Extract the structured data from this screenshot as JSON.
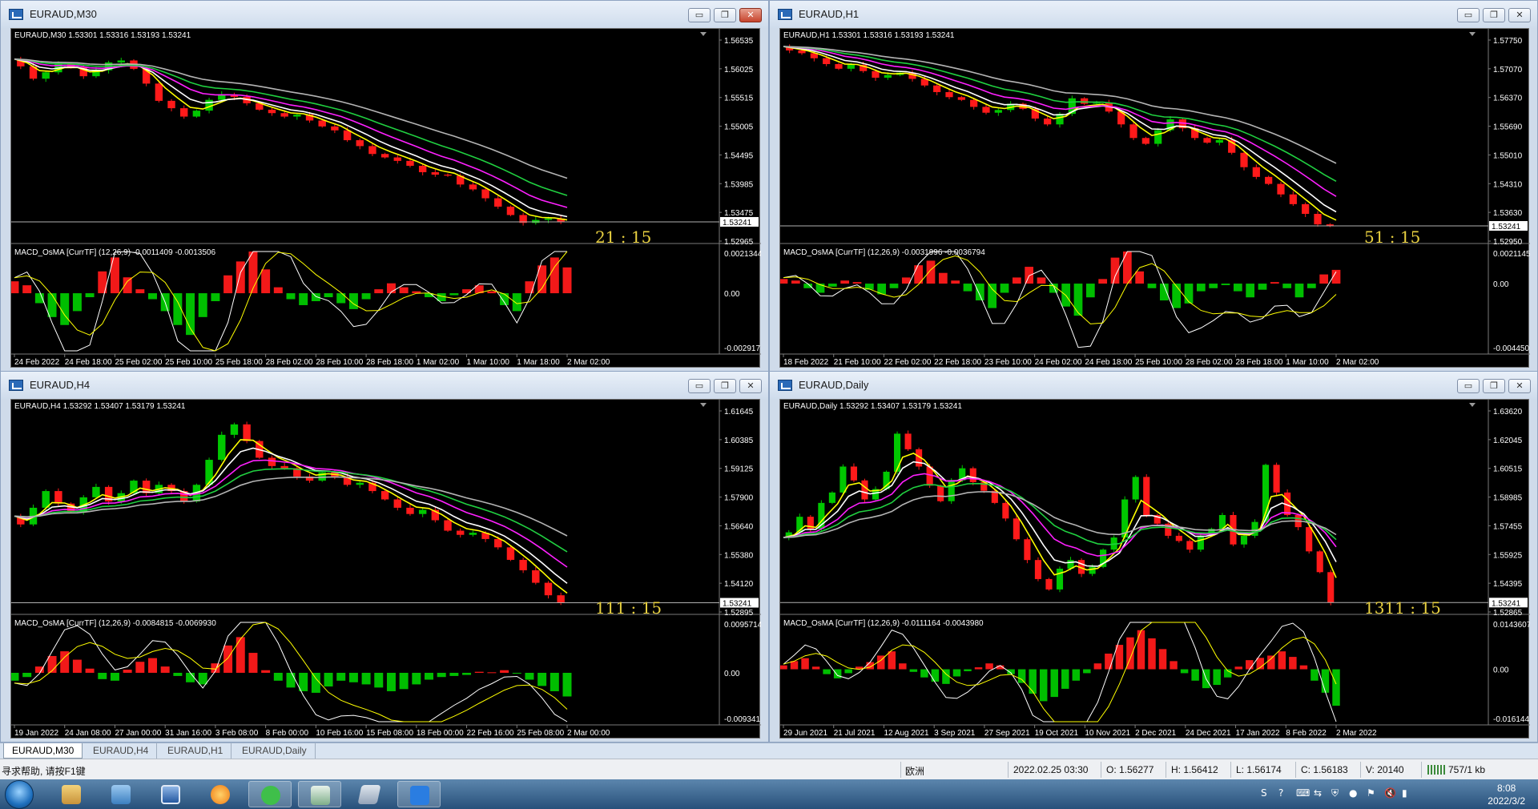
{
  "colors": {
    "up": "#00c800",
    "down": "#ff1a1a",
    "ema1": "#ffff00",
    "ema2": "#ffffff",
    "ema3": "#ff20ff",
    "ema4": "#20d040",
    "ema5": "#b4b4b4",
    "grid": "#7a7a7a",
    "text": "#ffffff",
    "timer": "#e8d040"
  },
  "windows": [
    {
      "title": "EURAUD,M30",
      "ohlc_label": "EURAUD,M30  1.53301 1.53316 1.53193 1.53241",
      "price_labels": [
        "1.56535",
        "1.56025",
        "1.55515",
        "1.55005",
        "1.54495",
        "1.53985",
        "1.53475",
        "1.52965"
      ],
      "last_price": "1.53241",
      "timer": "21 : 15",
      "macd_label": "MACD_OsMA [CurrTF] (12,26,9) -0.0011409 -0.0013506",
      "macd_labels": [
        "0.0021344",
        "0.00",
        "-0.002917"
      ],
      "time_labels": [
        "24 Feb 2022",
        "24 Feb 18:00",
        "25 Feb 02:00",
        "25 Feb 10:00",
        "25 Feb 18:00",
        "28 Feb 02:00",
        "28 Feb 10:00",
        "28 Feb 18:00",
        "1 Mar 02:00",
        "1 Mar 10:00",
        "1 Mar 18:00",
        "2 Mar 02:00"
      ],
      "buttons": {
        "minimize": "▭",
        "restore": "❐",
        "close": "✕"
      },
      "chart_data": {
        "type": "candlestick",
        "ylim": [
          1.5285,
          1.57
        ],
        "price_path": [
          1.5655,
          1.564,
          1.5615,
          1.5628,
          1.5645,
          1.5638,
          1.562,
          1.5632,
          1.5648,
          1.5652,
          1.5635,
          1.5605,
          1.557,
          1.5555,
          1.5538,
          1.555,
          1.5572,
          1.5583,
          1.5578,
          1.5565,
          1.5552,
          1.5545,
          1.5538,
          1.5542,
          1.553,
          1.5518,
          1.551,
          1.549,
          1.5478,
          1.5462,
          1.5455,
          1.5448,
          1.5438,
          1.5425,
          1.542,
          1.5418,
          1.54,
          1.539,
          1.5372,
          1.5355,
          1.5338,
          1.5322,
          1.5328,
          1.5331,
          1.5324
        ],
        "macd_hist": [
          0.0006,
          0.0004,
          -0.0005,
          -0.0012,
          -0.0016,
          -0.0009,
          -0.0002,
          0.0011,
          0.0018,
          0.0008,
          0.0002,
          -0.0003,
          -0.0009,
          -0.0016,
          -0.0021,
          -0.0012,
          -0.0004,
          0.0009,
          0.0016,
          0.0021,
          0.0012,
          0.0003,
          -0.0003,
          -0.0006,
          -0.0004,
          -0.0002,
          -0.0005,
          -0.0008,
          -0.0003,
          0.0002,
          0.0005,
          0.0003,
          0.0001,
          -0.0002,
          -0.0004,
          -0.0001,
          0.0002,
          0.0004,
          0.0001,
          -0.0006,
          -0.0009,
          0.0006,
          0.0014,
          0.0018,
          0.0013
        ],
        "macd_range": [
          -0.0029,
          0.0021
        ]
      }
    },
    {
      "title": "EURAUD,H1",
      "ohlc_label": "EURAUD,H1  1.53301 1.53316 1.53193 1.53241",
      "price_labels": [
        "1.57750",
        "1.57070",
        "1.56370",
        "1.55690",
        "1.55010",
        "1.54310",
        "1.53630",
        "1.52950"
      ],
      "last_price": "1.53241",
      "timer": "51 : 15",
      "macd_label": "MACD_OsMA [CurrTF] (12,26,9) -0.0031996 -0.0036794",
      "macd_labels": [
        "0.0021145",
        "0.00",
        "-0.004450"
      ],
      "time_labels": [
        "18 Feb 2022",
        "21 Feb 10:00",
        "22 Feb 02:00",
        "22 Feb 18:00",
        "23 Feb 10:00",
        "24 Feb 02:00",
        "24 Feb 18:00",
        "25 Feb 10:00",
        "28 Feb 02:00",
        "28 Feb 18:00",
        "1 Mar 10:00",
        "2 Mar 02:00"
      ],
      "buttons": {
        "minimize": "▭",
        "restore": "❐",
        "close": "✕"
      },
      "chart_data": {
        "type": "candlestick",
        "ylim": [
          1.5285,
          1.581
        ],
        "price_path": [
          1.5785,
          1.5775,
          1.5768,
          1.5755,
          1.574,
          1.5728,
          1.5738,
          1.5722,
          1.5705,
          1.5712,
          1.5718,
          1.5702,
          1.5685,
          1.5668,
          1.5655,
          1.5648,
          1.563,
          1.5615,
          1.5622,
          1.5638,
          1.5625,
          1.56,
          1.5585,
          1.5612,
          1.5652,
          1.5638,
          1.564,
          1.5618,
          1.5585,
          1.555,
          1.5535,
          1.557,
          1.5598,
          1.5575,
          1.555,
          1.5538,
          1.5545,
          1.5512,
          1.5475,
          1.545,
          1.5432,
          1.5405,
          1.538,
          1.5355,
          1.5328,
          1.5324
        ],
        "macd_hist": [
          0.0003,
          0.0002,
          -0.0003,
          -0.0006,
          -0.0002,
          0.0002,
          0.0001,
          -0.0004,
          -0.0007,
          -0.0003,
          0.0004,
          0.0012,
          0.0015,
          0.0007,
          0.0002,
          -0.0005,
          -0.0011,
          -0.0016,
          -0.0006,
          0.0004,
          0.0011,
          0.0004,
          -0.0006,
          -0.0015,
          -0.0021,
          -0.0009,
          0.0003,
          0.0017,
          0.0021,
          0.0008,
          -0.0003,
          -0.0011,
          -0.0016,
          -0.0013,
          -0.0005,
          -0.0003,
          -0.0001,
          -0.0005,
          -0.0009,
          -0.0004,
          0.0001,
          -0.0003,
          -0.0009,
          -0.0003,
          0.0006,
          0.0009
        ],
        "macd_range": [
          -0.0044,
          0.0021
        ]
      }
    },
    {
      "title": "EURAUD,H4",
      "ohlc_label": "EURAUD,H4  1.53292 1.53407 1.53179 1.53241",
      "price_labels": [
        "1.61645",
        "1.60385",
        "1.59125",
        "1.57900",
        "1.56640",
        "1.55380",
        "1.54120",
        "1.52895"
      ],
      "last_price": "1.53241",
      "timer": "111 : 15",
      "macd_label": "MACD_OsMA [CurrTF] (12,26,9) -0.0084815 -0.0069930",
      "macd_labels": [
        "0.0095714",
        "0.00",
        "-0.009341"
      ],
      "time_labels": [
        "19 Jan 2022",
        "24 Jan 08:00",
        "27 Jan 00:00",
        "31 Jan 16:00",
        "3 Feb 08:00",
        "8 Feb 00:00",
        "10 Feb 16:00",
        "15 Feb 08:00",
        "18 Feb 00:00",
        "22 Feb 16:00",
        "25 Feb 08:00",
        "2 Mar 00:00"
      ],
      "buttons": {
        "minimize": "▭",
        "restore": "❐",
        "close": "✕"
      },
      "chart_data": {
        "type": "candlestick",
        "ylim": [
          1.528,
          1.626
        ],
        "price_path": [
          1.574,
          1.57,
          1.578,
          1.586,
          1.58,
          1.576,
          1.583,
          1.588,
          1.581,
          1.585,
          1.591,
          1.585,
          1.589,
          1.586,
          1.581,
          1.589,
          1.601,
          1.613,
          1.618,
          1.61,
          1.602,
          1.598,
          1.597,
          1.593,
          1.591,
          1.595,
          1.593,
          1.589,
          1.59,
          1.586,
          1.582,
          1.578,
          1.575,
          1.577,
          1.572,
          1.567,
          1.565,
          1.566,
          1.563,
          1.559,
          1.553,
          1.548,
          1.542,
          1.536,
          1.5324
        ],
        "macd_hist": [
          -0.0015,
          -0.0008,
          0.0012,
          0.0032,
          0.0041,
          0.0025,
          0.0008,
          -0.0012,
          -0.0015,
          0.0006,
          0.0021,
          0.0028,
          0.0012,
          -0.0006,
          -0.0018,
          -0.0022,
          0.0018,
          0.0052,
          0.0068,
          0.0038,
          0.0005,
          -0.0015,
          -0.0028,
          -0.0035,
          -0.0038,
          -0.0026,
          -0.0015,
          -0.0018,
          -0.0022,
          -0.0028,
          -0.0035,
          -0.0031,
          -0.0022,
          -0.0013,
          -0.0008,
          -0.0006,
          -0.0004,
          0.0002,
          0.0001,
          0.0005,
          -0.0001,
          -0.0013,
          -0.0025,
          -0.0035,
          -0.0045
        ],
        "macd_range": [
          -0.0093,
          0.0096
        ]
      }
    },
    {
      "title": "EURAUD,Daily",
      "ohlc_label": "EURAUD,Daily  1.53292 1.53407 1.53179 1.53241",
      "price_labels": [
        "1.63620",
        "1.62045",
        "1.60515",
        "1.58985",
        "1.57455",
        "1.55925",
        "1.54395",
        "1.52865"
      ],
      "last_price": "1.53241",
      "timer": "1311 : 15",
      "macd_label": "MACD_OsMA [CurrTF] (12,26,9) -0.0111164 -0.0043980",
      "macd_labels": [
        "0.0143607",
        "0.00",
        "-0.016144"
      ],
      "time_labels": [
        "29 Jun 2021",
        "21 Jul 2021",
        "12 Aug 2021",
        "3 Sep 2021",
        "27 Sep 2021",
        "19 Oct 2021",
        "10 Nov 2021",
        "2 Dec 2021",
        "24 Dec 2021",
        "17 Jan 2022",
        "8 Feb 2022",
        "2 Mar 2022"
      ],
      "buttons": {
        "minimize": "▭",
        "restore": "❐",
        "close": "✕"
      },
      "chart_data": {
        "type": "candlestick",
        "ylim": [
          1.527,
          1.645
        ],
        "price_path": [
          1.57,
          1.573,
          1.582,
          1.575,
          1.59,
          1.596,
          1.611,
          1.603,
          1.592,
          1.598,
          1.608,
          1.63,
          1.621,
          1.611,
          1.6,
          1.591,
          1.603,
          1.61,
          1.602,
          1.597,
          1.59,
          1.581,
          1.569,
          1.557,
          1.546,
          1.54,
          1.552,
          1.557,
          1.549,
          1.553,
          1.563,
          1.57,
          1.592,
          1.605,
          1.583,
          1.578,
          1.571,
          1.568,
          1.563,
          1.571,
          1.575,
          1.583,
          1.566,
          1.571,
          1.579,
          1.612,
          1.596,
          1.583,
          1.576,
          1.562,
          1.55,
          1.5324
        ],
        "macd_hist": [
          0.0012,
          0.0025,
          0.0034,
          0.0008,
          -0.0015,
          -0.0028,
          -0.0012,
          0.0008,
          0.0022,
          0.0042,
          0.0055,
          0.0018,
          -0.0008,
          -0.0025,
          -0.0038,
          -0.0045,
          -0.0022,
          -0.0006,
          0.0006,
          0.0018,
          0.0012,
          -0.0015,
          -0.0042,
          -0.0075,
          -0.0098,
          -0.0085,
          -0.006,
          -0.0035,
          -0.0012,
          0.0018,
          0.0048,
          0.0075,
          0.0098,
          0.012,
          0.0095,
          0.0062,
          0.0025,
          -0.0012,
          -0.0035,
          -0.0058,
          -0.0048,
          -0.0025,
          0.0008,
          0.0028,
          0.0035,
          0.0042,
          0.0055,
          0.0038,
          0.0012,
          -0.0035,
          -0.0072,
          -0.0112
        ],
        "macd_range": [
          -0.0161,
          0.0144
        ]
      }
    }
  ],
  "tabs": [
    "EURAUD,M30",
    "EURAUD,H4",
    "EURAUD,H1",
    "EURAUD,Daily"
  ],
  "status": {
    "help": "寻求帮助, 请按F1键",
    "profile": "欧洲",
    "datetime": "2022.02.25 03:30",
    "open": "O: 1.56277",
    "high": "H: 1.56412",
    "low": "L: 1.56174",
    "close": "C: 1.56183",
    "volume": "V: 20140",
    "traffic": "757/1 kb"
  },
  "tray": {
    "time": "8:08",
    "date": "2022/3/2"
  }
}
